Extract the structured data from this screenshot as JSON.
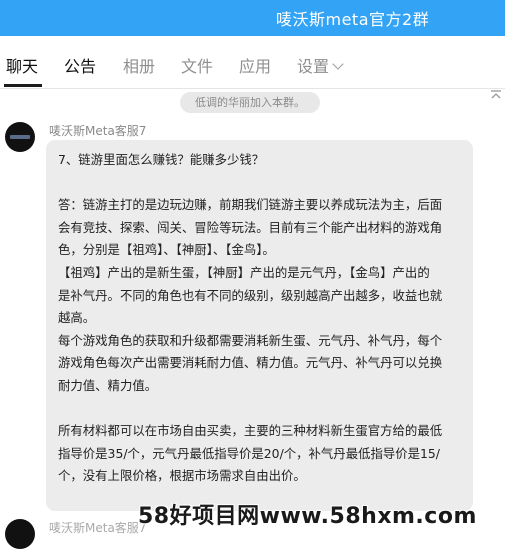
{
  "window": {
    "title": "唛沃斯meta官方2群"
  },
  "tabs": [
    {
      "label": "聊天"
    },
    {
      "label": "公告"
    },
    {
      "label": "相册"
    },
    {
      "label": "文件"
    },
    {
      "label": "应用"
    },
    {
      "label": "设置"
    }
  ],
  "system_notice": "低调的华丽加入本群。",
  "message": {
    "sender": "唛沃斯Meta客服7",
    "lines": [
      "7、链游里面怎么赚钱？能赚多少钱？",
      "",
      "答：链游主打的是边玩边赚，前期我们链游主要以养成玩法为主，后面",
      "会有竞技、探索、闯关、冒险等玩法。目前有三个能产出材料的游戏角",
      "色，分别是【祖鸡】、【神厨】、【金鸟】。",
      "【祖鸡】产出的是新生蛋，【神厨】产出的是元气丹，【金鸟】产出的",
      "是补气丹。不同的角色也有不同的级别，级别越高产出越多，收益也就",
      "越高。",
      "每个游戏角色的获取和升级都需要消耗新生蛋、元气丹、补气丹，每个",
      "游戏角色每次产出需要消耗耐力值、精力值。元气丹、补气丹可以兑换",
      "耐力值、精力值。",
      "",
      "所有材料都可以在市场自由买卖，主要的三种材料新生蛋官方给的最低",
      "指导价是35/个，元气丹最低指导价是20/个，补气丹最低指导价是15/",
      "个，没有上限价格，根据市场需求自由出价。"
    ]
  },
  "next_message": {
    "sender": "唛沃斯Meta客服7"
  },
  "watermark": "58好项目网www.58hxm.com",
  "colors": {
    "accent": "#33a3f5",
    "bubble": "#ececec"
  },
  "icons": {
    "settings_dropdown": "chevron-down-icon",
    "scroll_top": "arrow-up-icon"
  }
}
